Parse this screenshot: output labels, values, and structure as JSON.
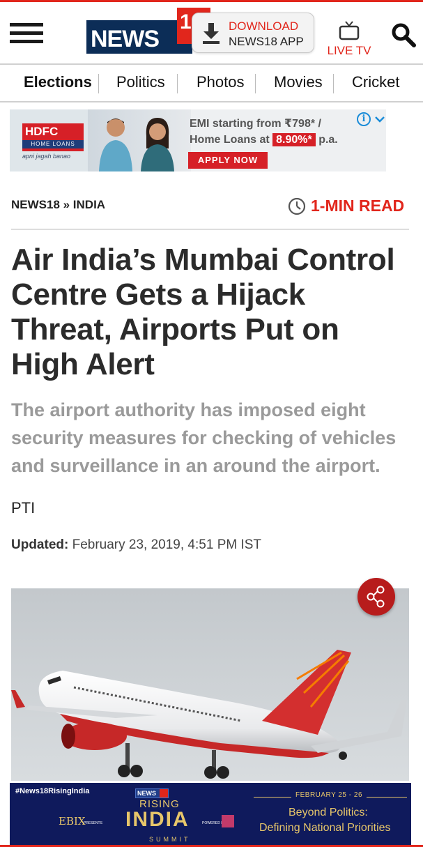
{
  "header": {
    "logo_text": "NEWS",
    "logo_number": "18",
    "download": {
      "line1": "DOWNLOAD",
      "line2": "NEWS18 APP"
    },
    "live_tv": "LIVE TV"
  },
  "nav": {
    "items": [
      {
        "label": "Elections",
        "active": true
      },
      {
        "label": "Politics",
        "active": false
      },
      {
        "label": "Photos",
        "active": false
      },
      {
        "label": "Movies",
        "active": false
      },
      {
        "label": "Cricket",
        "active": false
      }
    ]
  },
  "ad": {
    "brand": "HDFC",
    "brand_sub": "HOME LOANS",
    "tagline": "apni jagah banao",
    "line1": "EMI starting from ₹798* /",
    "line2_prefix": "Home Loans at",
    "rate": "8.90%*",
    "line2_suffix": "p.a.",
    "cta": "APPLY NOW"
  },
  "article": {
    "breadcrumb": "NEWS18 » INDIA",
    "read_time": "1-MIN READ",
    "headline": "Air India’s Mumbai Control Centre Gets a Hijack Threat, Airports Put on High Alert",
    "summary": "The airport authority has imposed eight security measures for checking of vehicles and surveillance in an around the airport.",
    "author": "PTI",
    "updated_label": "Updated:",
    "updated_value": "February 23, 2019, 4:51 PM IST"
  },
  "banner": {
    "hashtag": "#News18RisingIndia",
    "sponsor": "EBIX",
    "presents": "PRESENTS",
    "news18": "NEWS",
    "rising": "RISING",
    "india": "INDIA",
    "summit": "SUMMIT",
    "powered_by": "POWERED BY",
    "date": "FEBRUARY 25 - 26",
    "title_line1": "Beyond Politics:",
    "title_line2": "Defining National Priorities"
  },
  "colors": {
    "brand_red": "#e1261c",
    "brand_navy": "#0c2d57",
    "banner_navy": "#0f1a5c",
    "banner_gold": "#e7c66a",
    "summary_gray": "#9a9a9a"
  }
}
